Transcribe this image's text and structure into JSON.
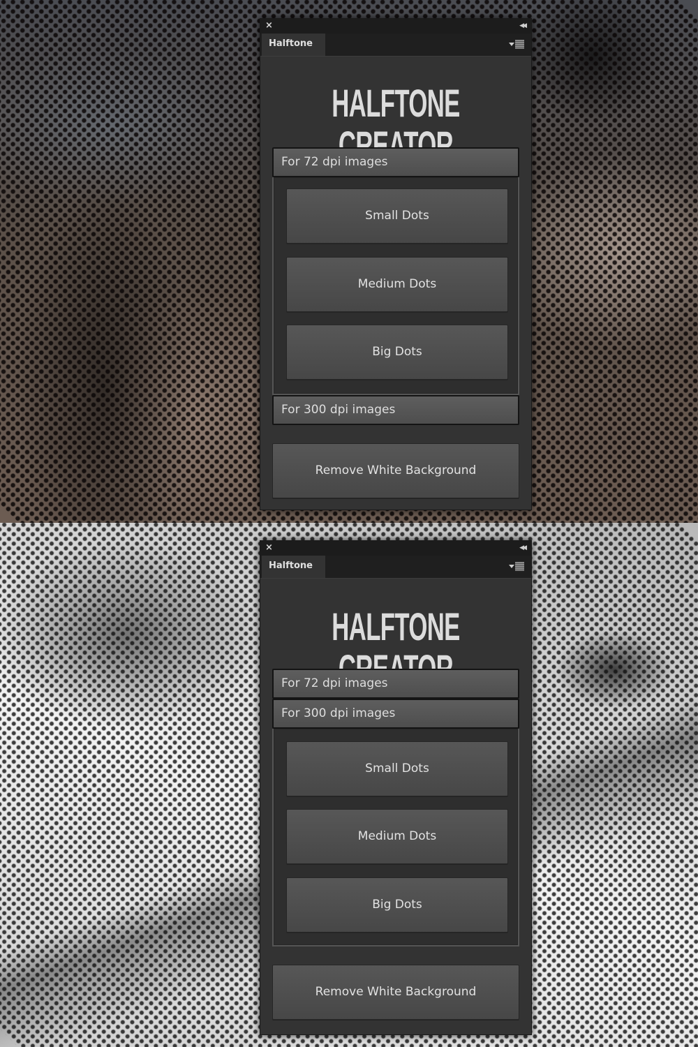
{
  "panels": [
    {
      "id": "top",
      "state": "72 dpi section expanded",
      "window": {
        "close_icon": "×",
        "collapse_icon": "◀◀"
      },
      "tab": {
        "label": "Halftone"
      },
      "title": "HALFTONE CREATOR",
      "sections": [
        {
          "label": "For 72 dpi images",
          "expanded": true,
          "buttons": [
            "Small Dots",
            "Medium Dots",
            "Big Dots"
          ]
        },
        {
          "label": "For 300 dpi images",
          "expanded": false
        }
      ],
      "remove_button": "Remove White Background"
    },
    {
      "id": "bottom",
      "state": "300 dpi section expanded",
      "window": {
        "close_icon": "×",
        "collapse_icon": "◀◀"
      },
      "tab": {
        "label": "Halftone"
      },
      "title": "HALFTONE CREATOR",
      "sections": [
        {
          "label": "For 72 dpi images",
          "expanded": false
        },
        {
          "label": "For 300 dpi images",
          "expanded": true,
          "buttons": [
            "Small Dots",
            "Medium Dots",
            "Big Dots"
          ]
        }
      ],
      "remove_button": "Remove White Background"
    }
  ],
  "colors": {
    "panel_bg": "#333333",
    "titlebar_bg": "#1c1c1c",
    "button_bg": "#4f4f4f",
    "text": "#e0e0e0"
  }
}
